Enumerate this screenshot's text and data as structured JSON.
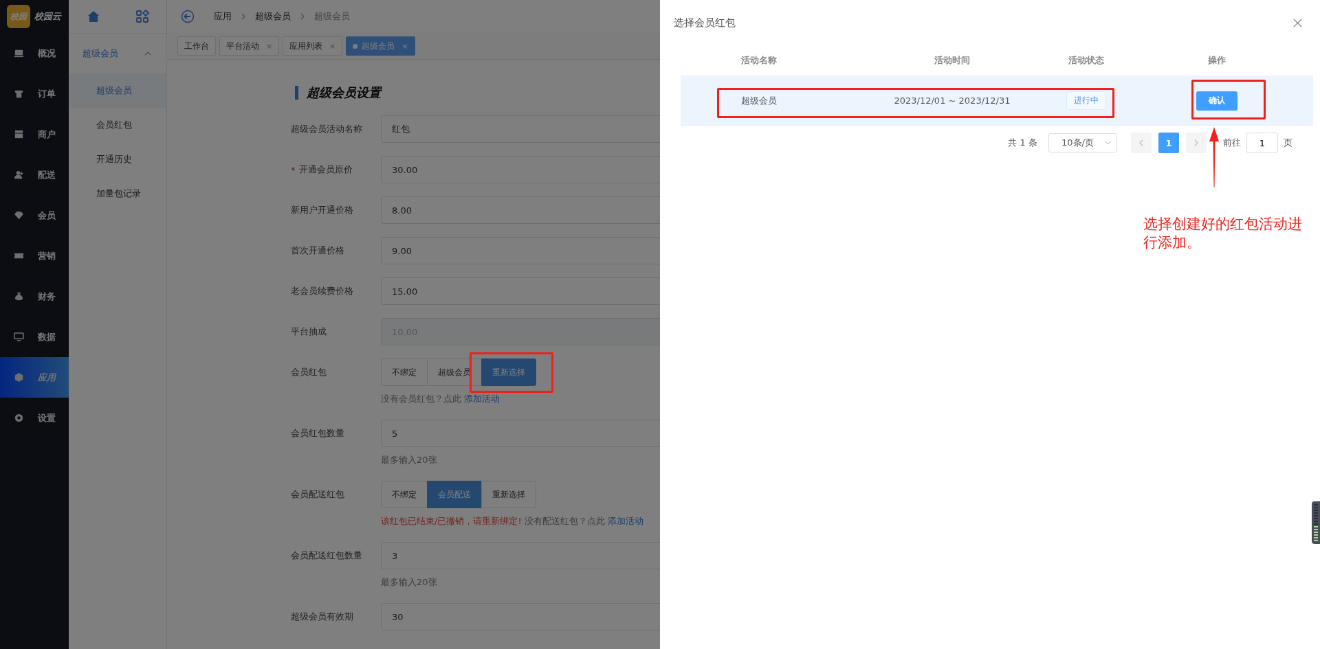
{
  "sidebar": {
    "logo": {
      "badge": "校园",
      "name": "校园云"
    },
    "items": [
      {
        "label": "概况",
        "selected": false
      },
      {
        "label": "订单",
        "selected": false
      },
      {
        "label": "商户",
        "selected": false
      },
      {
        "label": "配送",
        "selected": false
      },
      {
        "label": "会员",
        "selected": false
      },
      {
        "label": "营销",
        "selected": false
      },
      {
        "label": "财务",
        "selected": false
      },
      {
        "label": "数据",
        "selected": false
      },
      {
        "label": "应用",
        "selected": true
      },
      {
        "label": "设置",
        "selected": false
      }
    ]
  },
  "subnav": {
    "group": {
      "label": "超级会员",
      "expanded": true
    },
    "items": [
      {
        "label": "超级会员",
        "selected": true
      },
      {
        "label": "会员红包",
        "selected": false
      },
      {
        "label": "开通历史",
        "selected": false
      },
      {
        "label": "加量包记录",
        "selected": false
      }
    ]
  },
  "breadcrumb": [
    "应用",
    "超级会员",
    "超级会员"
  ],
  "tabs": [
    {
      "label": "工作台",
      "selected": false
    },
    {
      "label": "平台活动",
      "close": "×",
      "selected": false
    },
    {
      "label": "应用列表",
      "close": "×",
      "selected": false
    },
    {
      "label": "超级会员",
      "close": "×",
      "selected": true
    }
  ],
  "form": {
    "title": "超级会员设置",
    "fields": [
      {
        "kind": "input",
        "label": "超级会员活动名称",
        "value": "红包",
        "disabled": false
      },
      {
        "kind": "input",
        "label": "开通会员原价",
        "required_mark": "*",
        "value": "30.00",
        "disabled": false
      },
      {
        "kind": "input",
        "label": "新用户开通价格",
        "value": "8.00",
        "disabled": false
      },
      {
        "kind": "input",
        "label": "首次开通价格",
        "value": "9.00",
        "disabled": false
      },
      {
        "kind": "input",
        "label": "老会员续费价格",
        "value": "15.00",
        "disabled": false
      },
      {
        "kind": "input",
        "label": "平台抽成",
        "value": "10.00",
        "disabled": true
      },
      {
        "kind": "choice",
        "label": "会员红包",
        "options": [
          {
            "label": "不绑定",
            "selected": false
          },
          {
            "label": "超级会员",
            "selected": false
          },
          {
            "label": "重新选择",
            "selected": true
          }
        ],
        "note": [
          {
            "kind": "text",
            "text": "没有会员红包？点此"
          },
          {
            "kind": "link",
            "text": "添加活动"
          }
        ]
      },
      {
        "kind": "input",
        "label": "会员红包数量",
        "value": "5",
        "disabled": false,
        "hint": "最多输入20张"
      },
      {
        "kind": "choice",
        "label": "会员配送红包",
        "options": [
          {
            "label": "不绑定",
            "selected": false
          },
          {
            "label": "会员配送",
            "selected": true
          },
          {
            "label": "重新选择",
            "selected": false
          }
        ],
        "note": [
          {
            "kind": "error",
            "text": "该红包已结束/已撤销，请重新绑定!"
          },
          {
            "kind": "text",
            "text": "没有配送红包？点此"
          },
          {
            "kind": "link",
            "text": "添加活动"
          }
        ]
      },
      {
        "kind": "input",
        "label": "会员配送红包数量",
        "value": "3",
        "disabled": false,
        "hint": "最多输入20张"
      },
      {
        "kind": "input",
        "label": "超级会员有效期",
        "value": "30",
        "disabled": false
      }
    ]
  },
  "drawer": {
    "title": "选择会员红包",
    "table": {
      "columns": [
        "活动名称",
        "活动时间",
        "活动状态",
        "操作"
      ],
      "rows": [
        {
          "name": "超级会员",
          "time": "2023/12/01 ~ 2023/12/31",
          "status": "进行中",
          "action": "确认",
          "selected": true
        }
      ]
    },
    "pagination": {
      "total": "共 1 条",
      "page_size": "10条/页",
      "pages": [
        {
          "label": "1",
          "selected": true
        }
      ],
      "goto_label": "前往",
      "goto_value": "1",
      "goto_unit": "页"
    }
  },
  "annotation": {
    "text": "选择创建好的红包活动进行添加。"
  }
}
